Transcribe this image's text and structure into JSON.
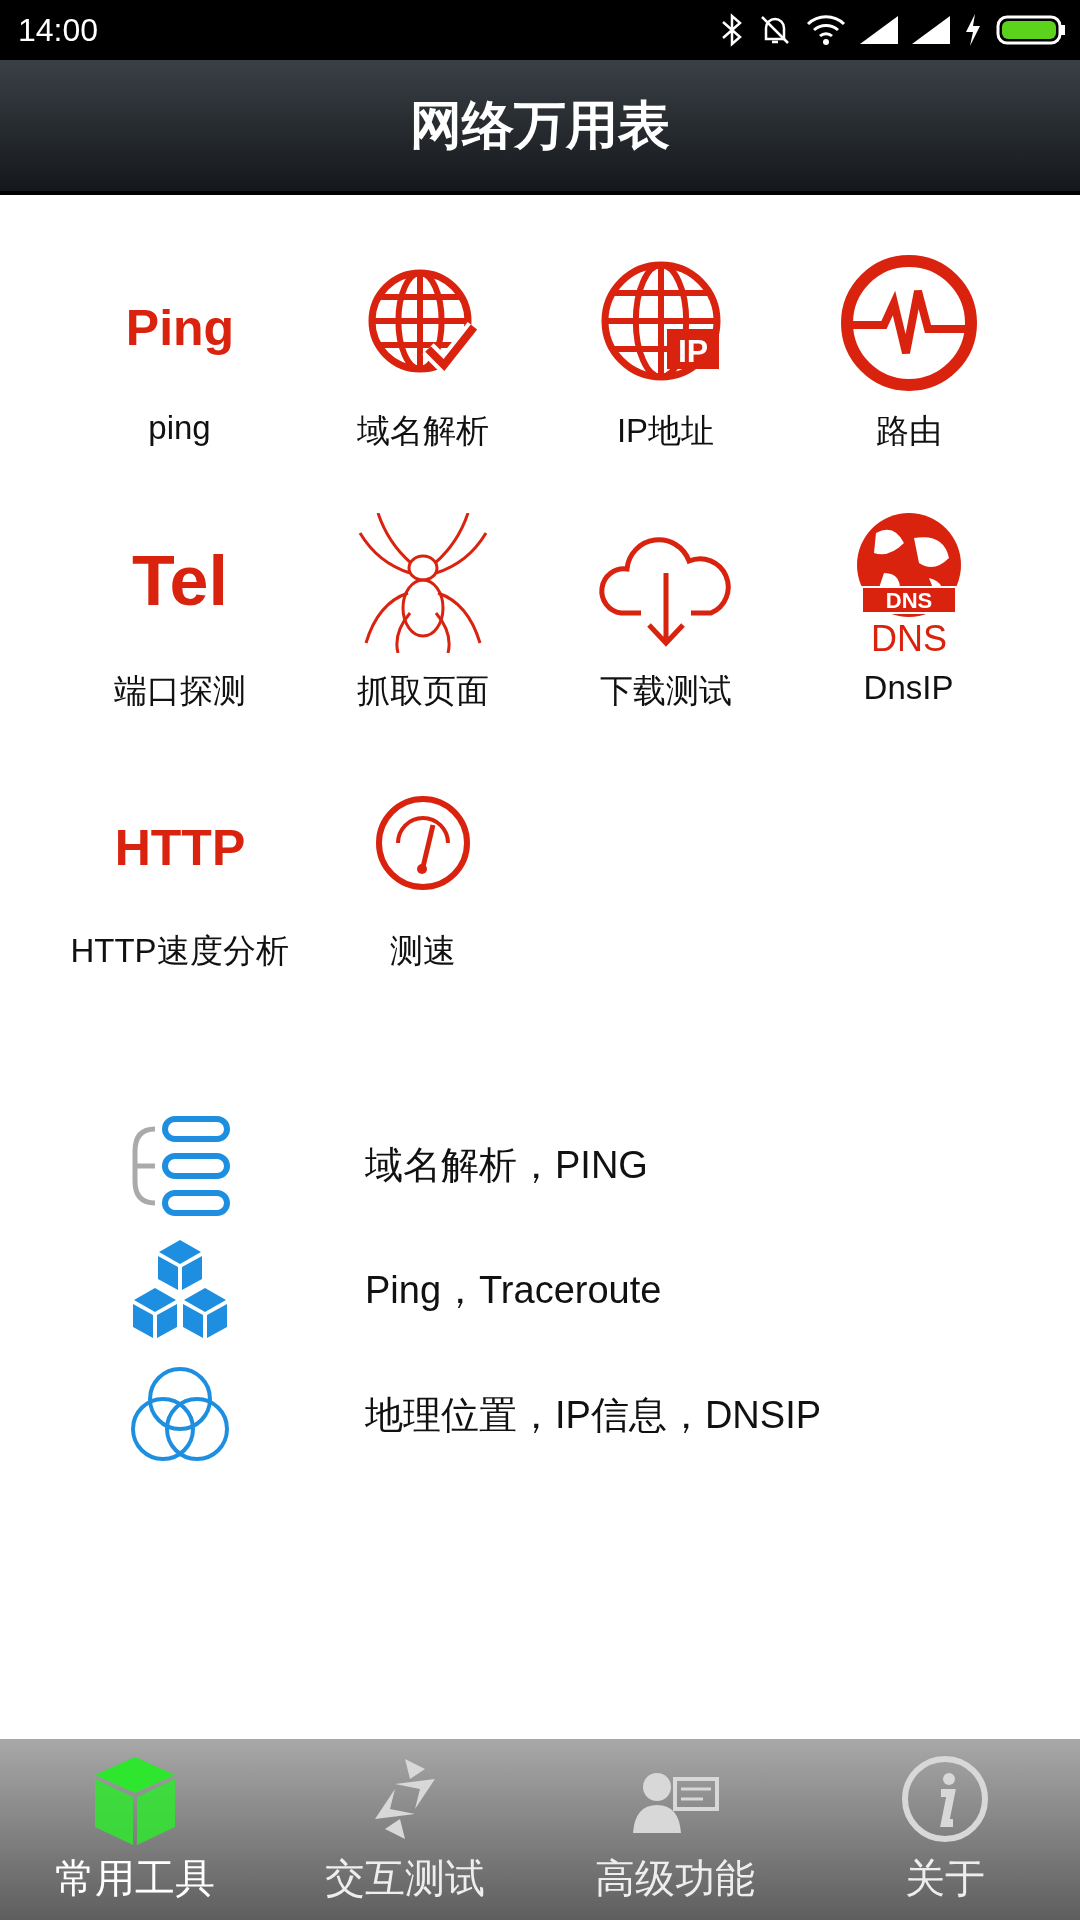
{
  "status_bar": {
    "time": "14:00"
  },
  "header": {
    "title": "网络万用表"
  },
  "tools": [
    {
      "label": "ping",
      "kind": "text",
      "icon_text": "Ping"
    },
    {
      "label": "域名解析",
      "kind": "globe-check"
    },
    {
      "label": "IP地址",
      "kind": "globe-badge",
      "icon_text": "IP"
    },
    {
      "label": "路由",
      "kind": "pulse"
    },
    {
      "label": "端口探测",
      "kind": "text",
      "icon_text": "Tel"
    },
    {
      "label": "抓取页面",
      "kind": "spider"
    },
    {
      "label": "下载测试",
      "kind": "cloud"
    },
    {
      "label": "DnsIP",
      "kind": "dns-globe",
      "badge_text": "DNS",
      "icon_text": "DNS"
    },
    {
      "label": "HTTP速度分析",
      "kind": "text",
      "icon_text": "HTTP"
    },
    {
      "label": "测速",
      "kind": "gauge"
    }
  ],
  "features": [
    {
      "text": "域名解析，PING",
      "kind": "layers"
    },
    {
      "text": "Ping，Traceroute",
      "kind": "cubes"
    },
    {
      "text": "地理位置，IP信息，DNSIP",
      "kind": "rings"
    }
  ],
  "tabs": [
    {
      "label": "常用工具",
      "kind": "cube",
      "selected": true
    },
    {
      "label": "交互测试",
      "kind": "arrows",
      "selected": false
    },
    {
      "label": "高级功能",
      "kind": "person-board",
      "selected": false
    },
    {
      "label": "关于",
      "kind": "info",
      "selected": false
    }
  ]
}
